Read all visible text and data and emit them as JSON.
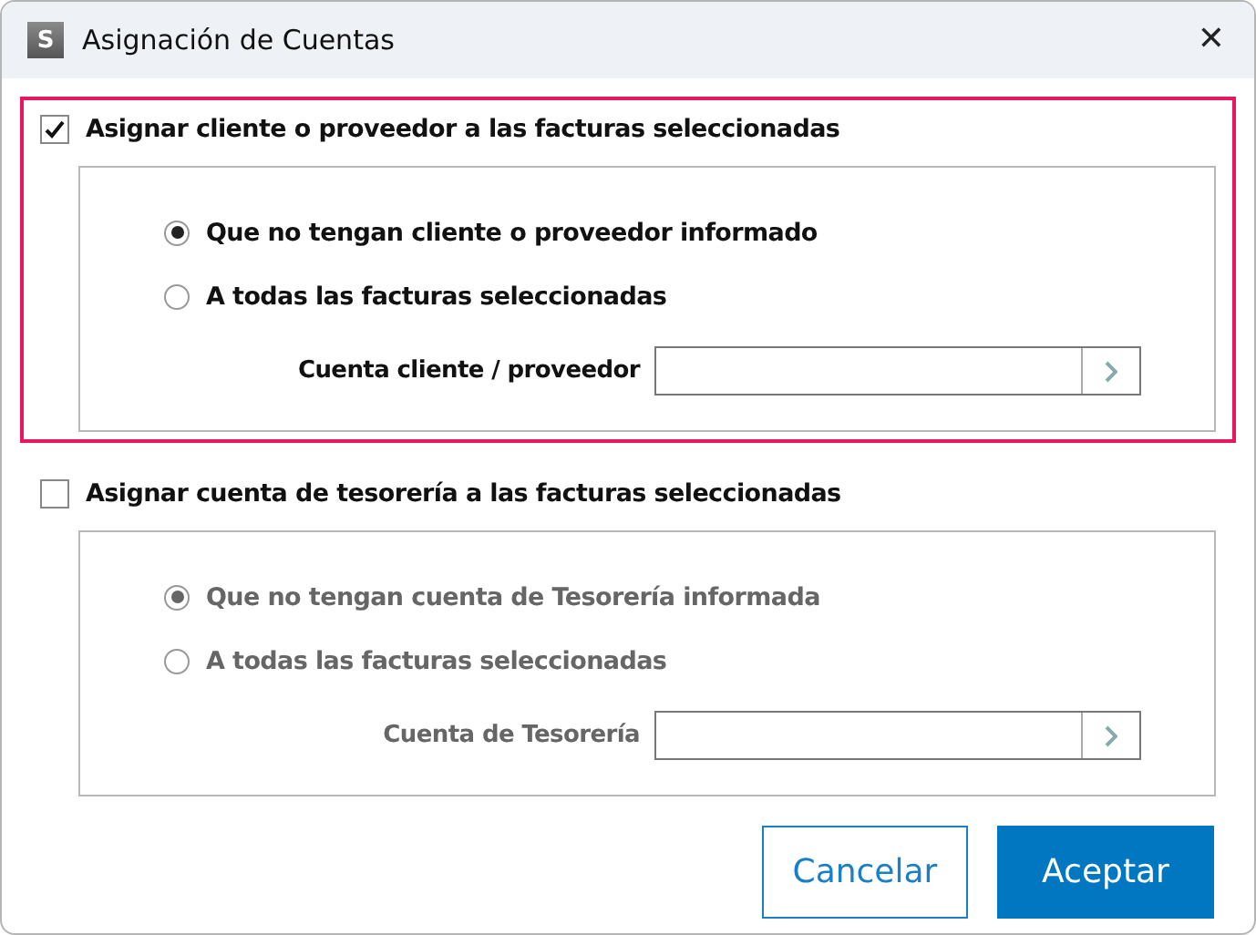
{
  "window": {
    "title": "Asignación de Cuentas",
    "logo": "S",
    "close": "✕"
  },
  "sections": [
    {
      "label": "Asignar cliente o proveedor a las facturas seleccionadas",
      "checked": true,
      "focused": true,
      "options": [
        {
          "label": "Que no tengan cliente o proveedor informado",
          "selected": true
        },
        {
          "label": "A todas las facturas seleccionadas",
          "selected": false
        }
      ],
      "field_label": "Cuenta cliente / proveedor"
    },
    {
      "label": "Asignar cuenta de tesorería a las facturas seleccionadas",
      "checked": false,
      "focused": false,
      "options": [
        {
          "label": "Que no tengan cuenta de Tesorería informada",
          "selected": true
        },
        {
          "label": "A todas las facturas seleccionadas",
          "selected": false
        }
      ],
      "field_label": "Cuenta de Tesorería"
    }
  ],
  "buttons": [
    {
      "label": "Cancelar",
      "kind": "secondary"
    },
    {
      "label": "Aceptar",
      "kind": "primary"
    }
  ]
}
